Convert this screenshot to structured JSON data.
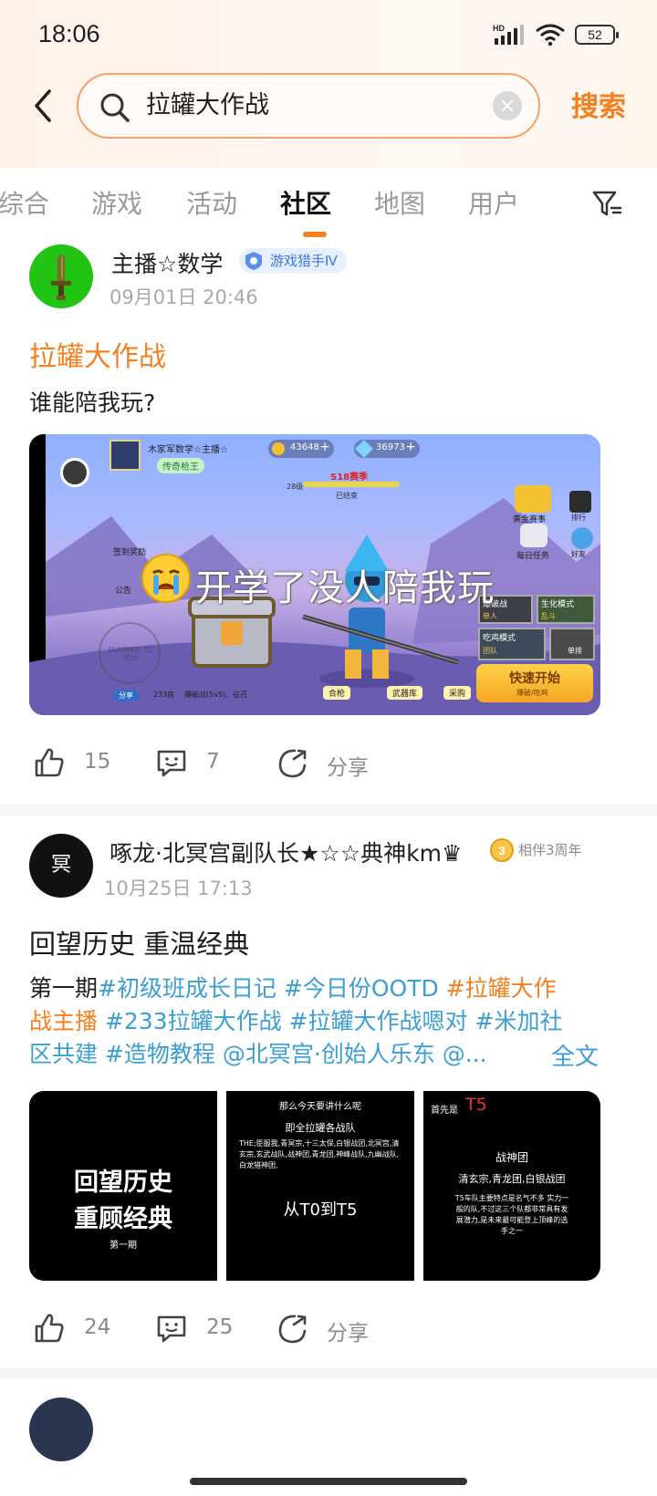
{
  "status": {
    "time": "18:06",
    "network": "HD",
    "battery": "52"
  },
  "search": {
    "query": "拉罐大作战",
    "submit_label": "搜索"
  },
  "tabs": [
    {
      "label": "综合"
    },
    {
      "label": "游戏"
    },
    {
      "label": "活动"
    },
    {
      "label": "社区",
      "active": true
    },
    {
      "label": "地图"
    },
    {
      "label": "用户"
    }
  ],
  "posts": [
    {
      "author": "主播☆数学",
      "badge": "游戏猎手Ⅳ",
      "date": "09月01日 20:46",
      "title": "拉罐大作战",
      "text": "谁能陪我玩?",
      "image": {
        "player_name": "木家军数学☆主播☆",
        "player_title": "传奇枪王",
        "currency_gold": "43648",
        "currency_gem": "36973",
        "season": "S18赛季",
        "season_status": "已结束",
        "level": "28级",
        "overlay_caption": "开学了没人陪我玩",
        "btn_signin": "签到奖励",
        "btn_notice": "公告",
        "btn_gold_match": "黄金赛事",
        "btn_rank": "排行",
        "btn_daily": "每日任务",
        "btn_friends": "好友",
        "mode_1": "爆破战",
        "mode_1_sub": "单人",
        "mode_2": "生化模式",
        "mode_2_sub": "乱斗",
        "mode_3": "吃鸡模式",
        "mode_3_sub": "团队",
        "mode_4": "单排",
        "quick_start": "快速开始",
        "quick_start_sub": "爆破/吃鸡",
        "room_id": "233房",
        "room_mode": "爆破战(5v5)、征召",
        "btn_friend_left": "分享",
        "btn_merge": "合枪",
        "btn_armory": "武器库",
        "btn_shop": "采购",
        "stamp_text": "SUMMER TO YOU"
      },
      "likes": "15",
      "comments": "7",
      "share": "分享"
    },
    {
      "author": "啄龙·北冥宫副队长★☆☆典神km♛",
      "avatar_char": "冥",
      "badge": "相伴3周年",
      "badge_num": "3",
      "date": "10月25日 17:13",
      "title": "回望历史 重温经典",
      "text_line1_plain": "第一期",
      "text_line1_tag1": "#初级班成长日记",
      "text_line1_tag2": "#今日份OOTD",
      "text_line1_tag3": "#拉罐大作",
      "text_line2_tag3_end": "战主播",
      "text_line2_tag4": "#233拉罐大作战",
      "text_line2_tag5": "#拉罐大作战嗯对",
      "text_line2_tag6": "#米加社",
      "text_line3_tag6_end": "区共建",
      "text_line3_tag7": "#造物教程",
      "text_line3_mention": "@北冥宫·创始人乐东",
      "text_line3_more": "@...",
      "expand": "全文",
      "images": [
        {
          "line1": "回望历史",
          "line2": "重顾经典",
          "line3": "第一期"
        },
        {
          "line1": "那么今天要讲什么呢",
          "line2": "即全拉罐各战队",
          "line3": "THE;臣服我,青冥宗,十三太保,白银战团,北冥宫,清玄宗,玄武战队,战神团,青龙团,神峰战队,九幽战队,白龙猎神团,",
          "line4": "从T0到T5"
        },
        {
          "prefix": "首先是",
          "tier": "T5",
          "line1": "战神团",
          "line2": "清玄宗,青龙团,白银战团",
          "line3": "T5车队主要特点是名气不多 实力一般的队,不过这三个队都非常具有发展潜力,是未来最可能登上顶峰的选手之一"
        }
      ],
      "likes": "24",
      "comments": "25",
      "share": "分享"
    }
  ],
  "colors": {
    "accent": "#f58022",
    "tag": "#3b9ed4",
    "meta": "#a9a9a9"
  }
}
